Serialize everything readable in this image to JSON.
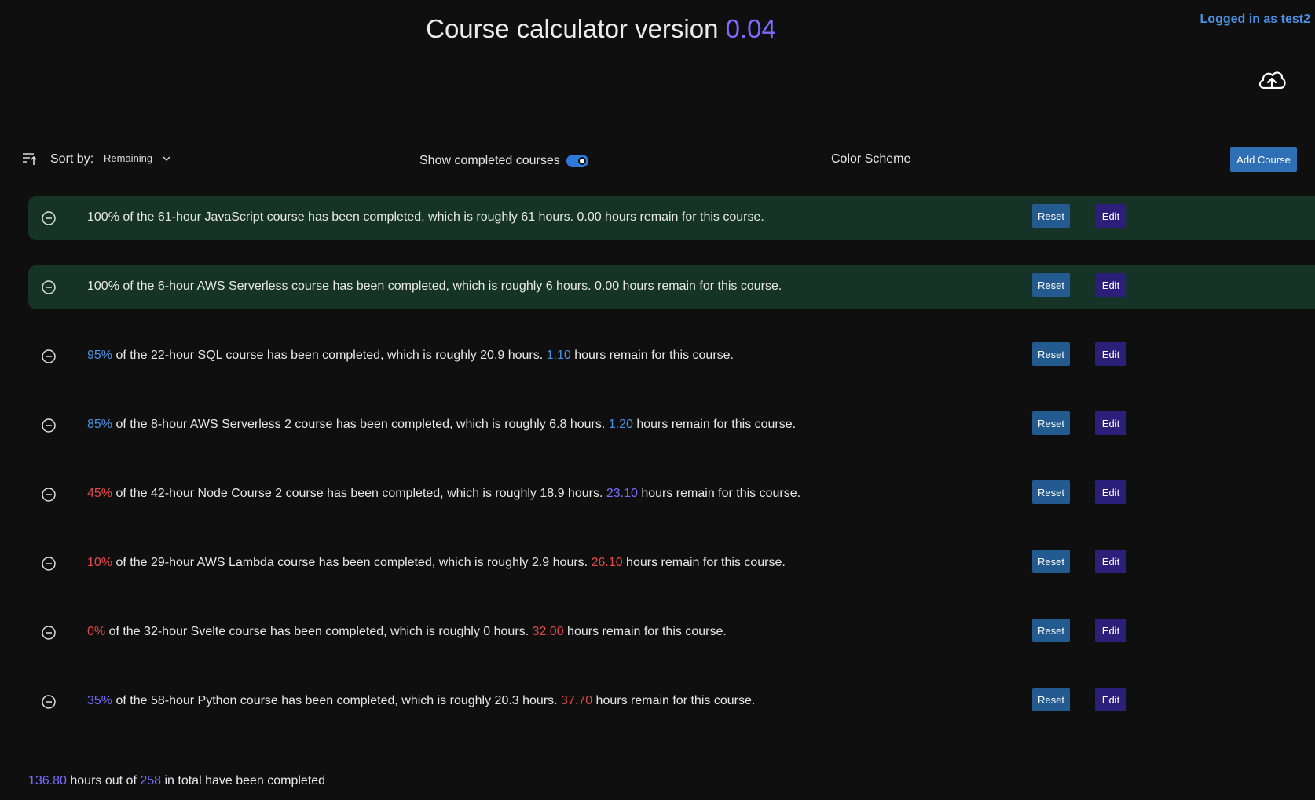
{
  "header": {
    "title": "Course calculator version ",
    "version": "0.04",
    "login": "Logged in as test2",
    "upload_icon": "cloud-upload-icon"
  },
  "toolbar": {
    "sort_label": "Sort by:",
    "sort_value": "Remaining",
    "show_completed_label": "Show completed courses",
    "show_completed_on": true,
    "color_scheme_label": "Color Scheme",
    "add_course_label": "Add Course"
  },
  "courses": [
    {
      "pct": "100%",
      "t1": " of the 61-hour JavaScript course has been completed, which is roughly 61 hours. ",
      "rem": "0.00",
      "t2": " hours remain for this course.",
      "done": true,
      "pct_color": "plain",
      "rem_color": "plain"
    },
    {
      "pct": "100%",
      "t1": " of the 6-hour AWS Serverless course has been completed, which is roughly 6 hours. ",
      "rem": "0.00",
      "t2": " hours remain for this course.",
      "done": true,
      "pct_color": "plain",
      "rem_color": "plain"
    },
    {
      "pct": "95%",
      "t1": " of the 22-hour SQL course has been completed, which is roughly 20.9 hours. ",
      "rem": "1.10",
      "t2": " hours remain for this course.",
      "done": false,
      "pct_color": "blue",
      "rem_color": "blue"
    },
    {
      "pct": "85%",
      "t1": " of the 8-hour AWS Serverless 2 course has been completed, which is roughly 6.8 hours. ",
      "rem": "1.20",
      "t2": " hours remain for this course.",
      "done": false,
      "pct_color": "blue",
      "rem_color": "blue"
    },
    {
      "pct": "45%",
      "t1": " of the 42-hour Node Course 2 course has been completed, which is roughly 18.9 hours. ",
      "rem": "23.10",
      "t2": " hours remain for this course.",
      "done": false,
      "pct_color": "red",
      "rem_color": "purple"
    },
    {
      "pct": "10%",
      "t1": " of the 29-hour AWS Lambda course has been completed, which is roughly 2.9 hours. ",
      "rem": "26.10",
      "t2": " hours remain for this course.",
      "done": false,
      "pct_color": "red",
      "rem_color": "red"
    },
    {
      "pct": "0%",
      "t1": " of the 32-hour Svelte course has been completed, which is roughly 0 hours. ",
      "rem": "32.00",
      "t2": " hours remain for this course.",
      "done": false,
      "pct_color": "red",
      "rem_color": "red"
    },
    {
      "pct": "35%",
      "t1": " of the 58-hour Python course has been completed, which is roughly 20.3 hours. ",
      "rem": "37.70",
      "t2": " hours remain for this course.",
      "done": false,
      "pct_color": "purple",
      "rem_color": "red"
    }
  ],
  "buttons": {
    "reset": "Reset",
    "edit": "Edit"
  },
  "total": {
    "done": "136.80",
    "mid": " hours out of ",
    "all": "258",
    "end": " in total have been completed"
  },
  "colors": {
    "background": "#0f0f0f",
    "done_row": "#163328",
    "blue": "#4a90e2",
    "purple": "#7b6cff",
    "red": "#e54848",
    "reset_btn": "#235a8f",
    "edit_btn": "#2c1f7a",
    "add_btn": "#2f6fb5"
  }
}
